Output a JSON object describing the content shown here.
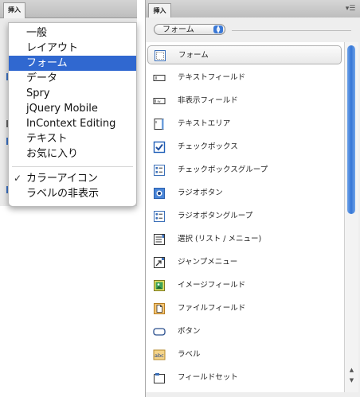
{
  "left": {
    "tab": "挿入",
    "menu": {
      "items": [
        {
          "label": "一般",
          "selected": false
        },
        {
          "label": "レイアウト",
          "selected": false
        },
        {
          "label": "フォーム",
          "selected": true
        },
        {
          "label": "データ",
          "selected": false
        },
        {
          "label": "Spry",
          "selected": false
        },
        {
          "label": "jQuery Mobile",
          "selected": false
        },
        {
          "label": "InContext Editing",
          "selected": false
        },
        {
          "label": "テキスト",
          "selected": false
        },
        {
          "label": "お気に入り",
          "selected": false
        }
      ],
      "options": [
        {
          "label": "カラーアイコン",
          "checked": true,
          "check_mark": "✓"
        },
        {
          "label": "ラベルの非表示",
          "checked": false
        }
      ]
    }
  },
  "right": {
    "tab": "挿入",
    "panel_menu_icon": "panel-options-icon",
    "category_select": {
      "value": "フォーム"
    },
    "items": [
      {
        "label": "フォーム",
        "icon": "form-icon",
        "selected": true
      },
      {
        "label": "テキストフィールド",
        "icon": "text-field-icon",
        "selected": false
      },
      {
        "label": "非表示フィールド",
        "icon": "hidden-field-icon",
        "selected": false
      },
      {
        "label": "テキストエリア",
        "icon": "textarea-icon",
        "selected": false
      },
      {
        "label": "チェックボックス",
        "icon": "checkbox-icon",
        "selected": false
      },
      {
        "label": "チェックボックスグループ",
        "icon": "checkbox-group-icon",
        "selected": false
      },
      {
        "label": "ラジオボタン",
        "icon": "radio-button-icon",
        "selected": false
      },
      {
        "label": "ラジオボタングループ",
        "icon": "radio-group-icon",
        "selected": false
      },
      {
        "label": "選択 (リスト / メニュー)",
        "icon": "select-list-icon",
        "selected": false
      },
      {
        "label": "ジャンプメニュー",
        "icon": "jump-menu-icon",
        "selected": false
      },
      {
        "label": "イメージフィールド",
        "icon": "image-field-icon",
        "selected": false
      },
      {
        "label": "ファイルフィールド",
        "icon": "file-field-icon",
        "selected": false
      },
      {
        "label": "ボタン",
        "icon": "button-icon",
        "selected": false
      },
      {
        "label": "ラベル",
        "icon": "label-icon",
        "selected": false
      },
      {
        "label": "フィールドセット",
        "icon": "fieldset-icon",
        "selected": false
      }
    ],
    "colors": {
      "accent": "#3068d0",
      "scroll": "#3576d6"
    }
  }
}
